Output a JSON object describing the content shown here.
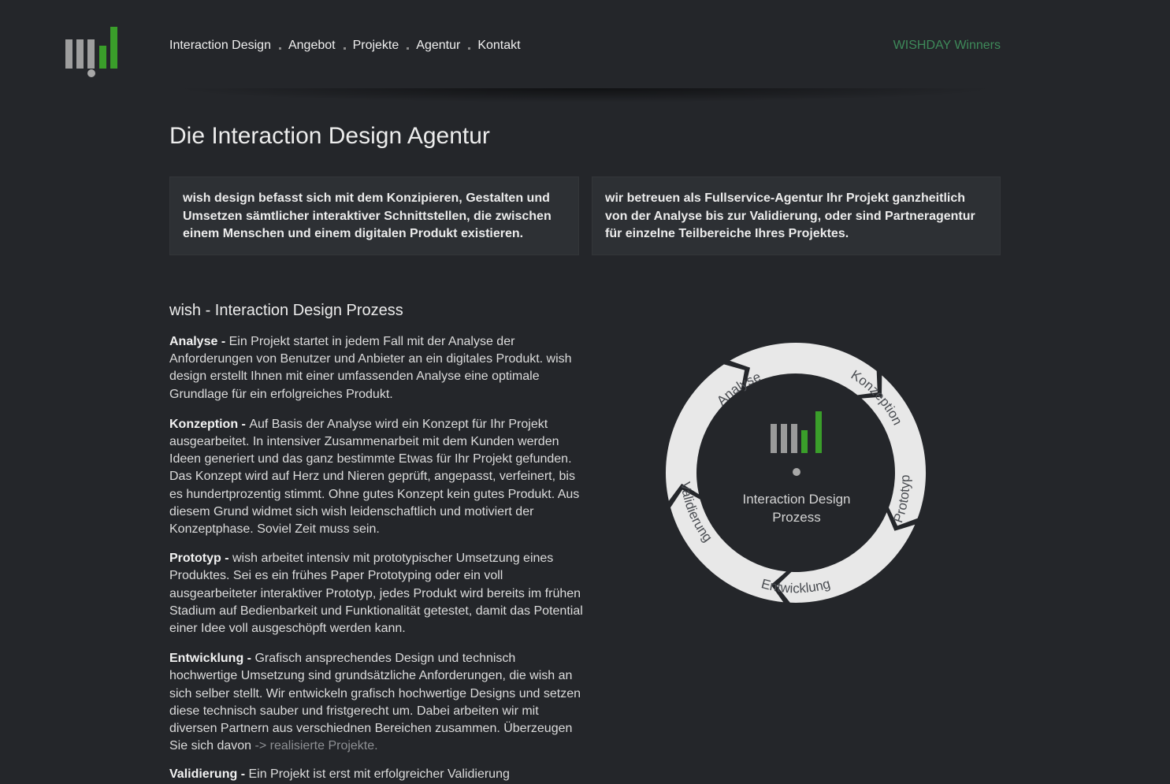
{
  "header": {
    "nav": [
      {
        "label": "Interaction Design"
      },
      {
        "label": "Angebot"
      },
      {
        "label": "Projekte"
      },
      {
        "label": "Agentur"
      },
      {
        "label": "Kontakt"
      }
    ],
    "winners_link": "WISHDAY Winners"
  },
  "main": {
    "title": "Die Interaction Design Agentur",
    "intro_left": "wish design befasst sich mit dem Konzipieren, Gestalten und Umsetzen sämtlicher interaktiver Schnittstellen, die zwischen einem Menschen und einem digitalen Produkt existieren.",
    "intro_right": "wir betreuen als Fullservice-Agentur Ihr Projekt ganzheitlich von der Analyse bis zur Validierung, oder sind Partneragentur für einzelne Teilbereiche Ihres Projektes.",
    "section_title": "wish - Interaction Design Prozess",
    "steps": {
      "analyse": {
        "term": "Analyse - ",
        "text": "Ein Projekt startet in jedem Fall mit der Analyse der Anforderungen von Benutzer und Anbieter an ein digitales Produkt. wish design erstellt Ihnen mit einer umfassenden Analyse eine optimale Grundlage für ein erfolgreiches Produkt."
      },
      "konzeption": {
        "term": "Konzeption - ",
        "text": "Auf Basis der Analyse wird ein Konzept für Ihr Projekt ausgearbeitet. In intensiver Zusammenarbeit mit dem Kunden werden Ideen generiert und das ganz bestimmte Etwas für Ihr Projekt gefunden.",
        "text2": "Das Konzept wird auf Herz und Nieren geprüft, angepasst, verfeinert, bis es hundertprozentig stimmt. Ohne gutes Konzept kein gutes Produkt. Aus diesem Grund widmet sich wish leidenschaftlich und motiviert der Konzeptphase. Soviel Zeit muss sein."
      },
      "prototyp": {
        "term": "Prototyp - ",
        "text": "wish arbeitet intensiv mit prototypischer Umsetzung eines Produktes. Sei es ein frühes Paper Prototyping oder ein voll ausgearbeiteter interaktiver Prototyp, jedes Produkt wird bereits im frühen Stadium auf Bedienbarkeit und Funktionalität getestet, damit das Potential einer Idee voll ausgeschöpft werden kann."
      },
      "entwicklung": {
        "term": "Entwicklung - ",
        "text": "Grafisch ansprechendes Design und technisch hochwertige Umsetzung sind grundsätzliche Anforderungen, die wish an sich selber stellt. Wir entwickeln grafisch hochwertige Designs und setzen diese technisch sauber und fristgerecht um. Dabei arbeiten wir mit diversen Partnern aus verschiednen Bereichen zusammen. Überzeugen Sie sich davon ",
        "link": "-> realisierte Projekte."
      },
      "validierung": {
        "term": "Validierung - ",
        "text": "Ein Projekt ist erst mit erfolgreicher Validierung"
      }
    }
  },
  "diagram": {
    "center_line1": "Interaction Design",
    "center_line2": "Prozess",
    "labels": {
      "analyse": "Analyse",
      "konzeption": "Konzeption",
      "prototyp": "Prototyp",
      "entwicklung": "Entwicklung",
      "validierung": "Validierung"
    }
  },
  "colors": {
    "background": "#24262a",
    "accent_green": "#3a9e2a",
    "winners_green": "#3e8a5a",
    "ring": "#e8e8e8"
  }
}
